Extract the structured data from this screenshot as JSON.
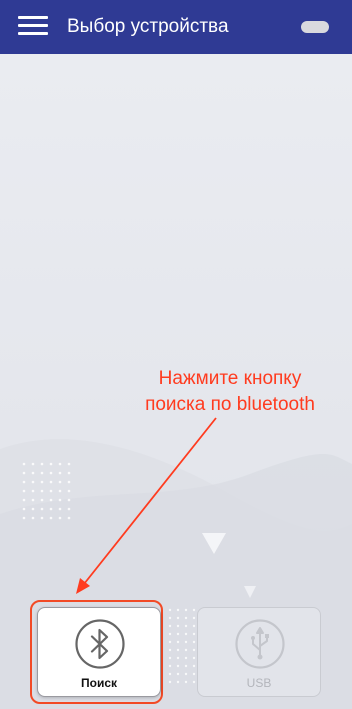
{
  "app_bar": {
    "title": "Выбор устройства",
    "menu_icon": "hamburger-menu-icon",
    "status_indicator": "pill-indicator",
    "background_color": "#2f3a94"
  },
  "annotation": {
    "lines": [
      "Нажмите кнопку",
      "поиска по bluetooth"
    ],
    "color": "#ff3b1f"
  },
  "devices": [
    {
      "label": "Поиск",
      "icon": "bluetooth-icon",
      "enabled": true,
      "highlighted": true
    },
    {
      "label": "USB",
      "icon": "usb-icon",
      "enabled": false,
      "highlighted": false
    }
  ]
}
